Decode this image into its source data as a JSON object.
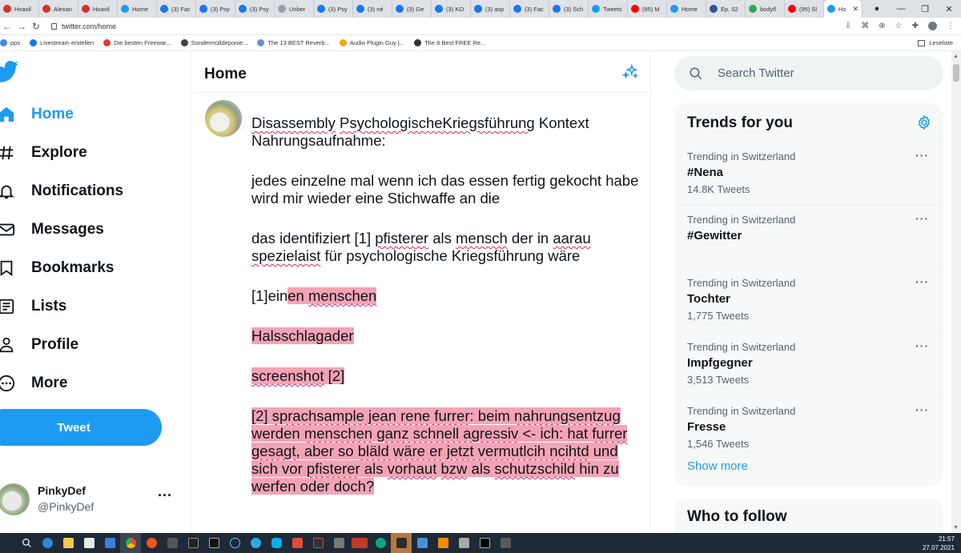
{
  "browser": {
    "tabs": [
      {
        "label": "Hoaxil",
        "color": "#d93025"
      },
      {
        "label": "Alexan",
        "color": "#d93025"
      },
      {
        "label": "Hoaxil",
        "color": "#d93025"
      },
      {
        "label": "Home",
        "color": "#1d9bf0"
      },
      {
        "label": "(3) Fac",
        "color": "#1877f2"
      },
      {
        "label": "(3) Psy",
        "color": "#1877f2"
      },
      {
        "label": "(3) Psy",
        "color": "#1877f2"
      },
      {
        "label": "Unber",
        "color": "#9aa0a6"
      },
      {
        "label": "(3) Psy",
        "color": "#1877f2"
      },
      {
        "label": "(3) né",
        "color": "#1877f2"
      },
      {
        "label": "(3) Ge",
        "color": "#1877f2"
      },
      {
        "label": "(3) KO",
        "color": "#1877f2"
      },
      {
        "label": "(3) asp",
        "color": "#1877f2"
      },
      {
        "label": "(3) Fac",
        "color": "#1877f2"
      },
      {
        "label": "(3) Sch",
        "color": "#1877f2"
      },
      {
        "label": "Tweets",
        "color": "#1d9bf0"
      },
      {
        "label": "(95) M",
        "color": "#ff0000"
      },
      {
        "label": "Home",
        "color": "#1d9bf0"
      },
      {
        "label": "Ep. 02",
        "color": "#2b5797"
      },
      {
        "label": "bodyfl",
        "color": "#34a853"
      },
      {
        "label": "(95) Sl",
        "color": "#ff0000"
      }
    ],
    "active_tab": {
      "label": "Ho",
      "color": "#1d9bf0"
    },
    "new_tab": "+",
    "url": "twitter.com/home",
    "bookmarks": [
      {
        "label": "pps",
        "color": "#4285f4"
      },
      {
        "label": "Livestream erstellen",
        "color": "#1877f2"
      },
      {
        "label": "Die besten Freewar...",
        "color": "#e53935"
      },
      {
        "label": "Sondermülldeponie...",
        "color": "#444444"
      },
      {
        "label": "The 13 BEST Reverb...",
        "color": "#6b8fd6"
      },
      {
        "label": "Audio Plugin Guy |...",
        "color": "#f2a900"
      },
      {
        "label": "The 8 Best FREE Re...",
        "color": "#333333"
      }
    ],
    "reading_list": "Leseliste"
  },
  "sidebar": {
    "items": [
      {
        "label": "Home",
        "icon": "home-icon"
      },
      {
        "label": "Explore",
        "icon": "hashtag-icon"
      },
      {
        "label": "Notifications",
        "icon": "bell-icon"
      },
      {
        "label": "Messages",
        "icon": "envelope-icon"
      },
      {
        "label": "Bookmarks",
        "icon": "bookmark-icon"
      },
      {
        "label": "Lists",
        "icon": "list-icon"
      },
      {
        "label": "Profile",
        "icon": "user-icon"
      },
      {
        "label": "More",
        "icon": "more-circle-icon"
      }
    ],
    "tweet_button": "Tweet",
    "account": {
      "name": "PinkyDef",
      "handle": "@PinkyDef",
      "more": "···"
    }
  },
  "main": {
    "title": "Home",
    "tweet": {
      "paragraphs": [
        [
          {
            "t": "Disassembly",
            "s": true
          },
          {
            "t": " "
          },
          {
            "t": "PsychologischeKriegsführung",
            "s": true
          },
          {
            "t": " Kontext Nahrungsaufnahme:"
          }
        ],
        [
          {
            "t": "jedes einzelne mal wenn ich das essen fertig gekocht habe wird mir wieder eine Stichwaffe an die"
          }
        ],
        [
          {
            "t": "das identifiziert [1] "
          },
          {
            "t": "pfisterer",
            "s": true
          },
          {
            "t": " als "
          },
          {
            "t": "mensch",
            "s": true
          },
          {
            "t": " der in "
          },
          {
            "t": "aarau",
            "s": true
          },
          {
            "t": " "
          },
          {
            "t": "spezielaist",
            "s": true
          },
          {
            "t": " für psychologische Kriegsführung wäre"
          }
        ],
        [
          {
            "t": "[1]ein"
          },
          {
            "t": "en ",
            "h": true
          },
          {
            "t": "menschen",
            "h": true,
            "s": true
          },
          {
            "t": "  ",
            "h": true
          }
        ],
        [
          {
            "t": "Halsschlagader",
            "h": true
          }
        ],
        [
          {
            "t": "screenshot",
            "h": true,
            "s": true
          },
          {
            "t": " [2]",
            "h": true
          }
        ],
        [
          {
            "t": "[2] ",
            "h": true
          },
          {
            "t": "sprachsample jean rene furrer",
            "h": true,
            "s": true
          },
          {
            "t": ": beim ",
            "h": true
          },
          {
            "t": "nahrungsentzug",
            "h": true,
            "s": true
          },
          {
            "t": " werden ",
            "h": true
          },
          {
            "t": "menschen",
            "h": true,
            "s": true
          },
          {
            "t": " ",
            "h": true
          },
          {
            "t": "ganz schnell agressiv",
            "h": true,
            "s": true
          },
          {
            "t": " <- ich: hat ",
            "h": true
          },
          {
            "t": "furrer gesagt",
            "h": true,
            "s": true
          },
          {
            "t": ", aber so ",
            "h": true
          },
          {
            "t": "bläld wäre er jetzt vermutlcih ncihtd",
            "h": true,
            "s": true
          },
          {
            "t": " und sich vor ",
            "h": true
          },
          {
            "t": "pfisterer",
            "h": true,
            "s": true
          },
          {
            "t": " als ",
            "h": true
          },
          {
            "t": "vorhaut",
            "h": true,
            "s": true
          },
          {
            "t": " ",
            "h": true
          },
          {
            "t": "bzw",
            "h": true,
            "s": true
          },
          {
            "t": " als ",
            "h": true
          },
          {
            "t": "schutzschild",
            "h": true,
            "s": true
          },
          {
            "t": " hin zu werfen oder doch?",
            "h": true
          }
        ]
      ]
    }
  },
  "right": {
    "search_placeholder": "Search Twitter",
    "trends_title": "Trends for you",
    "trends": [
      {
        "context": "Trending in Switzerland",
        "name": "#Nena",
        "count": "14.8K Tweets"
      },
      {
        "context": "Trending in Switzerland",
        "name": "#Gewitter",
        "count": ""
      },
      {
        "context": "Trending in Switzerland",
        "name": "Tochter",
        "count": "1,775 Tweets"
      },
      {
        "context": "Trending in Switzerland",
        "name": "Impfgegner",
        "count": "3,513 Tweets"
      },
      {
        "context": "Trending in Switzerland",
        "name": "Fresse",
        "count": "1,546 Tweets"
      }
    ],
    "trend_more": "···",
    "show_more": "Show more",
    "who_to_follow": "Who to follow"
  },
  "taskbar": {
    "time": "21:57",
    "date": "27.07.2021"
  },
  "colors": {
    "accent": "#1d9bf0",
    "highlight": "#f4a3b5",
    "spellcheck": "#e0245e"
  }
}
